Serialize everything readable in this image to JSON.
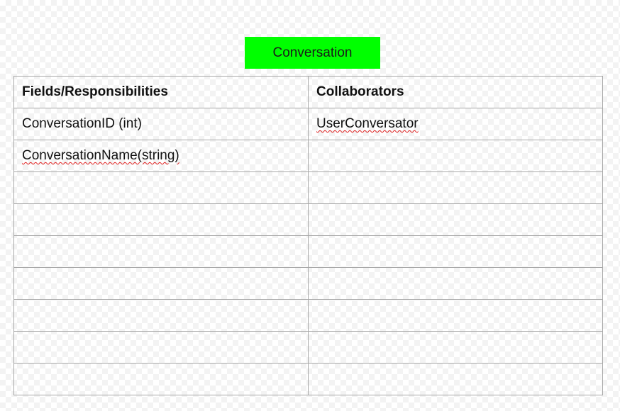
{
  "title": {
    "text": "Conversation",
    "background": "#00ff00"
  },
  "table": {
    "headers": [
      "Fields/Responsibilities",
      "Collaborators"
    ],
    "rows": [
      [
        "ConversationID (int)",
        "UserConversator"
      ],
      [
        "ConversationName(string)",
        ""
      ],
      [
        "",
        ""
      ],
      [
        "",
        ""
      ],
      [
        "",
        ""
      ],
      [
        "",
        ""
      ],
      [
        "",
        ""
      ],
      [
        "",
        ""
      ],
      [
        "",
        ""
      ]
    ]
  },
  "colors": {
    "border": "#a8a8a8",
    "spellcheck_underline": "#e02020"
  }
}
